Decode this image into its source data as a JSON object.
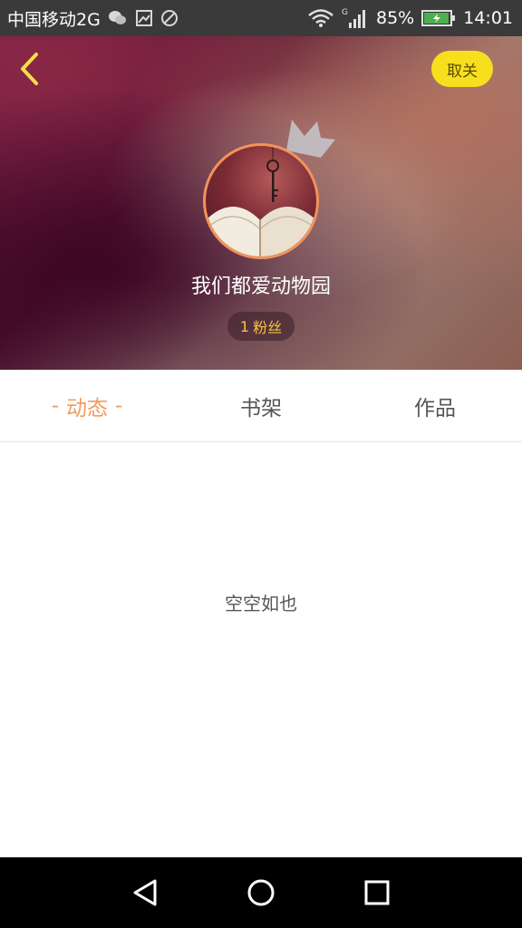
{
  "status_bar": {
    "carrier": "中国移动2G",
    "signal_type": "G",
    "battery": "85%",
    "time": "14:01"
  },
  "header": {
    "unfollow_label": "取关",
    "username": "我们都爱动物园",
    "fans_count": "1",
    "fans_label": "粉丝"
  },
  "tabs": [
    {
      "label": "动态",
      "active": true
    },
    {
      "label": "书架",
      "active": false
    },
    {
      "label": "作品",
      "active": false
    }
  ],
  "active_tab_dash": "-",
  "empty_text": "空空如也",
  "colors": {
    "accent": "#f39a5c",
    "unfollow_bg": "#f7df1e",
    "fans_text": "#f5c542",
    "back_arrow": "#f4e04a"
  },
  "icons": {
    "back": "chevron-left-icon",
    "crown": "crown-icon",
    "nav_back": "triangle-back-icon",
    "nav_home": "circle-home-icon",
    "nav_recents": "square-recents-icon"
  }
}
